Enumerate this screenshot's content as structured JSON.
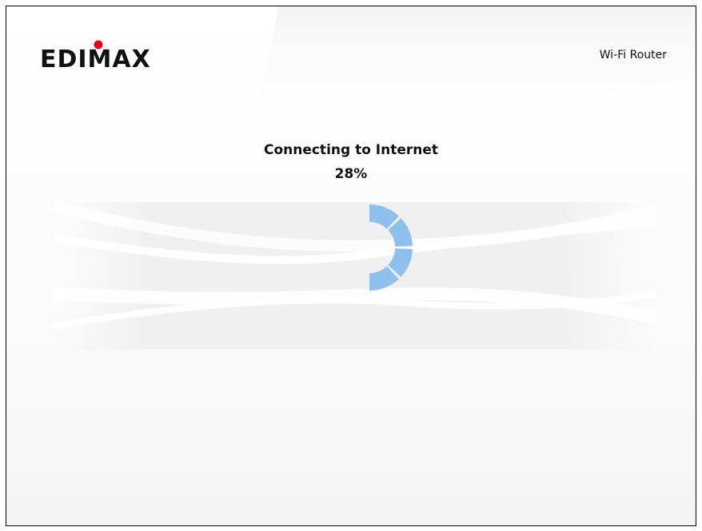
{
  "brand": {
    "logo_text": "EDIMAX",
    "product_name": "Wi-Fi Router"
  },
  "status": {
    "label": "Connecting to Internet",
    "progress_text": "28%",
    "progress_fraction": 0.28
  },
  "colors": {
    "spinner": "#8ec0ee",
    "logo_dot": "#e3001b",
    "text": "#111111"
  },
  "icons": {
    "spinner": "loading-spinner-icon"
  }
}
